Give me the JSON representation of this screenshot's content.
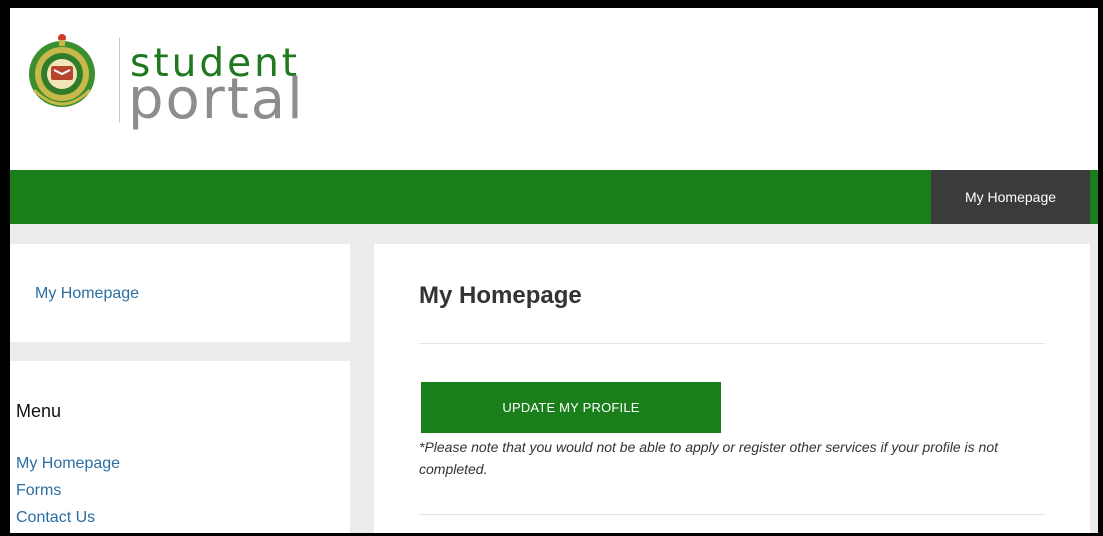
{
  "brand": {
    "line1": "student",
    "line2": "portal",
    "color_primary": "#1f7a1f",
    "color_secondary": "#8d8d8d"
  },
  "nav": {
    "active_item": "My Homepage",
    "bar_color": "#1a7f1a",
    "active_color": "#3b3b3b"
  },
  "sidebar": {
    "top_link": "My Homepage",
    "menu_title": "Menu",
    "menu_items": [
      {
        "label": "My Homepage"
      },
      {
        "label": "Forms"
      },
      {
        "label": "Contact Us"
      }
    ]
  },
  "main": {
    "title": "My Homepage",
    "update_button": "UPDATE MY PROFILE",
    "note": "*Please note that you would not be able to apply or register other services if your profile is not completed."
  },
  "icons": {
    "logo": "university-emblem-icon"
  }
}
